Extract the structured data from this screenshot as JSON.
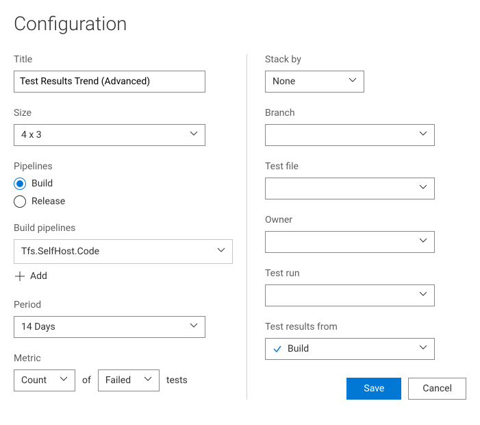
{
  "page_title": "Configuration",
  "left": {
    "title": {
      "label": "Title",
      "value": "Test Results Trend (Advanced)"
    },
    "size": {
      "label": "Size",
      "value": "4 x 3"
    },
    "pipelines": {
      "label": "Pipelines",
      "options": [
        {
          "label": "Build",
          "selected": true
        },
        {
          "label": "Release",
          "selected": false
        }
      ]
    },
    "build_pipelines": {
      "label": "Build pipelines",
      "items": [
        "Tfs.SelfHost.Code"
      ],
      "add_label": "Add"
    },
    "period": {
      "label": "Period",
      "value": "14 Days"
    },
    "metric": {
      "label": "Metric",
      "first": "Count",
      "joiner": "of",
      "second": "Failed",
      "suffix": "tests"
    }
  },
  "right": {
    "stack_by": {
      "label": "Stack by",
      "value": "None"
    },
    "branch": {
      "label": "Branch",
      "value": ""
    },
    "test_file": {
      "label": "Test file",
      "value": ""
    },
    "owner": {
      "label": "Owner",
      "value": ""
    },
    "test_run": {
      "label": "Test run",
      "value": ""
    },
    "test_results_from": {
      "label": "Test results from",
      "value": "Build"
    }
  },
  "buttons": {
    "save": "Save",
    "cancel": "Cancel"
  }
}
